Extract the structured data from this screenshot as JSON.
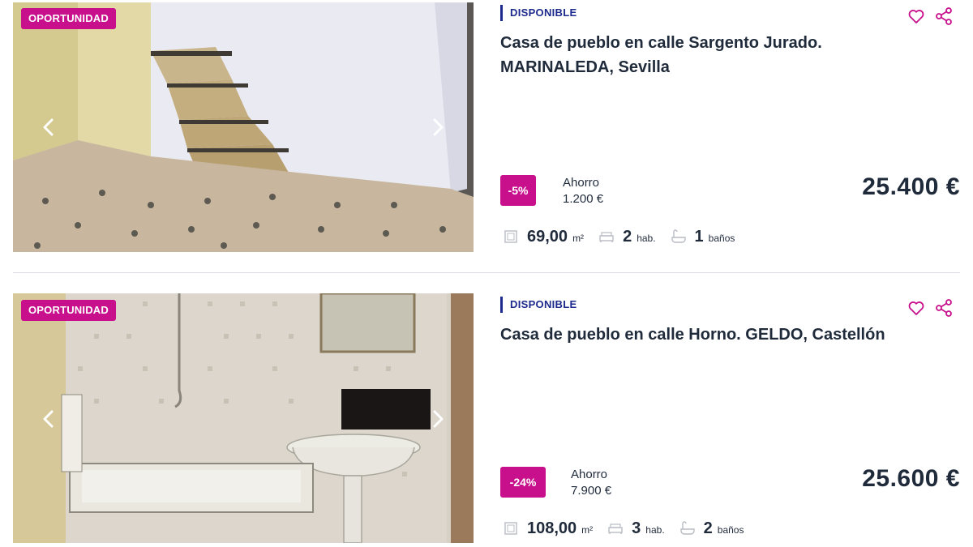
{
  "listings": [
    {
      "badge": "OPORTUNIDAD",
      "status": "DISPONIBLE",
      "title": "Casa de pueblo en calle Sargento Jurado. MARINALEDA, Sevilla",
      "discount": "-5%",
      "savings_label": "Ahorro",
      "savings_amount": "1.200 €",
      "price": "25.400 €",
      "area": "69,00",
      "area_unit": "m²",
      "rooms": "2",
      "rooms_unit": "hab.",
      "baths": "1",
      "baths_unit": "baños"
    },
    {
      "badge": "OPORTUNIDAD",
      "status": "DISPONIBLE",
      "title": "Casa de pueblo en calle Horno. GELDO, Castellón",
      "discount": "-24%",
      "savings_label": "Ahorro",
      "savings_amount": "7.900 €",
      "price": "25.600 €",
      "area": "108,00",
      "area_unit": "m²",
      "rooms": "3",
      "rooms_unit": "hab.",
      "baths": "2",
      "baths_unit": "baños"
    }
  ],
  "colors": {
    "accent": "#c8108c",
    "status": "#1b2a8c",
    "text": "#1f2a3a"
  },
  "icons": [
    "chevron-left-icon",
    "chevron-right-icon",
    "heart-icon",
    "share-icon",
    "area-icon",
    "bed-icon",
    "bath-icon"
  ]
}
